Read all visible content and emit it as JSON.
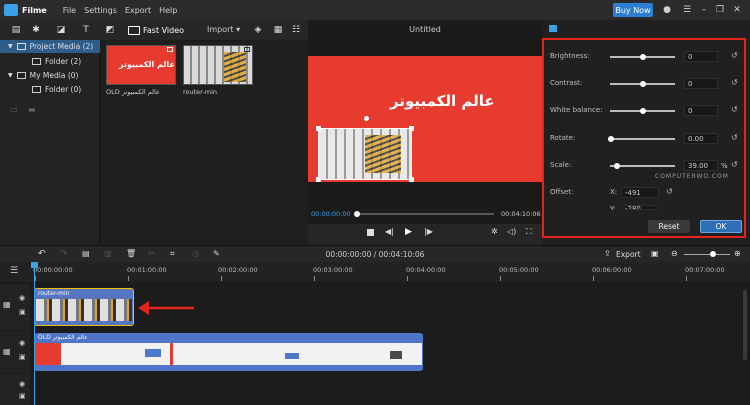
{
  "app": {
    "name": "Filme",
    "menu": [
      "File",
      "Settings",
      "Export",
      "Help"
    ],
    "buy_now": "Buy Now"
  },
  "toolbar": {
    "fast_video": "Fast Video",
    "import": "Import"
  },
  "sidebar": {
    "items": [
      {
        "label": "Project Media (2)",
        "level": 0,
        "selected": true
      },
      {
        "label": "Folder (2)",
        "level": 1
      },
      {
        "label": "My Media (0)",
        "level": 0
      },
      {
        "label": "Folder (0)",
        "level": 1
      }
    ]
  },
  "media": {
    "items": [
      {
        "label": "OLD عالم الكمبيوتر",
        "thumb_text": "عالم الكمبيوتر"
      },
      {
        "label": "router-min"
      }
    ]
  },
  "preview": {
    "title": "Untitled",
    "overlay_text": "عالم الكمبيوتر",
    "current_time": "00:00:00:00",
    "total_time": "00:04:10:06"
  },
  "properties": {
    "rows": [
      {
        "label": "Brightness:",
        "value": "0"
      },
      {
        "label": "Contrast:",
        "value": "0"
      },
      {
        "label": "White balance:",
        "value": "0"
      },
      {
        "label": "Rotate:",
        "value": "0.00"
      },
      {
        "label": "Scale:",
        "value": "39.00",
        "unit": "%"
      }
    ],
    "offset_label": "Offset:",
    "offset_x_label": "X:",
    "offset_x": "-491",
    "offset_y_label": "Y:",
    "offset_y": "-280",
    "watermark": "COMPUTERWO.COM",
    "reset": "Reset",
    "ok": "OK"
  },
  "timeline": {
    "timecode": "00:00:00:00 / 00:04:10:06",
    "export": "Export",
    "ruler": [
      "00:00:00:00",
      "00:01:00:00",
      "00:02:00:00",
      "00:03:00:00",
      "00:04:00:00",
      "00:05:00:00",
      "00:06:00:00",
      "00:07:00:00"
    ],
    "clip1_label": "router-min",
    "clip2_label": "OLD عالم الكمبيوتر"
  },
  "colors": {
    "accent_red": "#e63b2e",
    "accent_blue": "#2d7fd3",
    "clip_blue": "#4f74c8"
  }
}
